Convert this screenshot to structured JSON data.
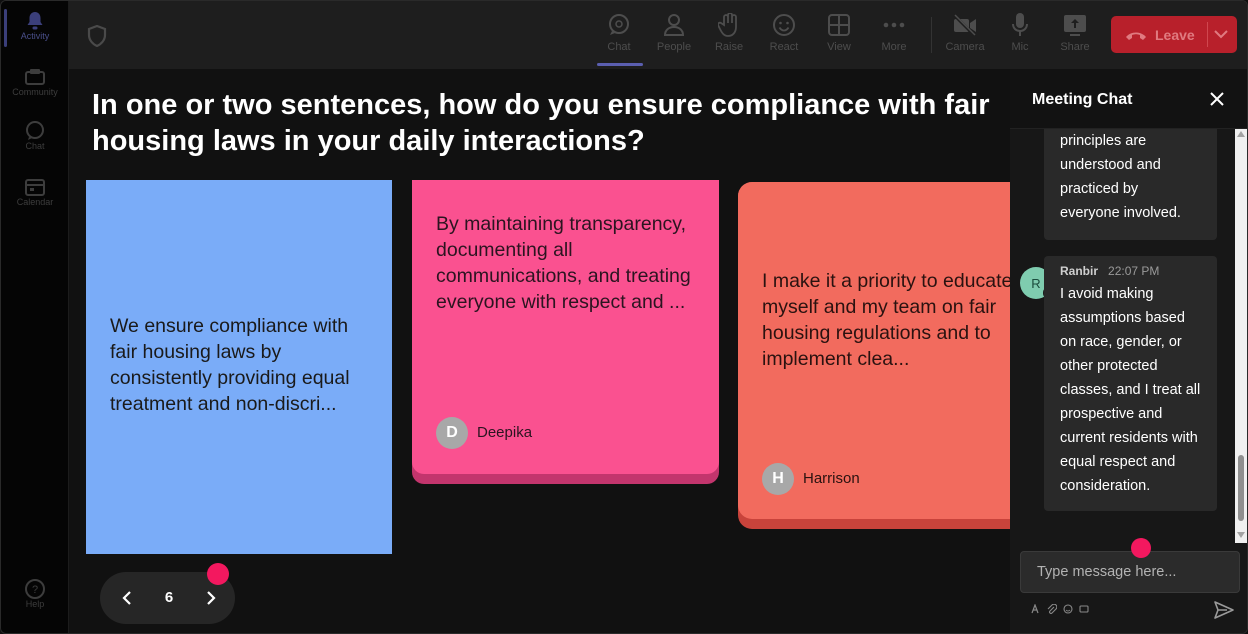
{
  "rail": {
    "items": [
      {
        "label": "Activity",
        "icon": "bell-icon",
        "active": true
      },
      {
        "label": "Community",
        "icon": "community-icon"
      },
      {
        "label": "Chat",
        "icon": "chat-icon"
      },
      {
        "label": "Calendar",
        "icon": "calendar-icon"
      }
    ],
    "help": {
      "label": "Help",
      "icon": "help-icon"
    }
  },
  "toolbar": {
    "chat": "Chat",
    "people": "People",
    "raise": "Raise",
    "react": "React",
    "view": "View",
    "more": "More",
    "camera": "Camera",
    "mic": "Mic",
    "share": "Share",
    "leave": "Leave"
  },
  "main": {
    "question": "In one or two sentences, how do you ensure compliance with fair housing laws in your daily interactions?",
    "cards": [
      {
        "text": "We ensure compliance with fair housing laws by consistently providing equal treatment and non-discri...",
        "color": "#7aacf8"
      },
      {
        "text": "By maintaining transparency, documenting all communications, and treating everyone with respect and ...",
        "author": "Deepika",
        "initial": "D",
        "color": "#fa5190"
      },
      {
        "text": "I make it a priority to educate myself and my team on fair housing regulations and to implement clea...",
        "author": "Harrison",
        "initial": "H",
        "color": "#f26b5e"
      }
    ],
    "pager": {
      "page": "6"
    }
  },
  "chat": {
    "title": "Meeting Chat",
    "messages": [
      {
        "text": "principles are understood and practiced by everyone involved."
      },
      {
        "author": "Ranbir",
        "initial": "R",
        "time": "22:07 PM",
        "text": "I avoid making assumptions based on race, gender, or other protected classes, and I treat all prospective and current residents with equal respect and consideration."
      }
    ],
    "input_placeholder": "Type message here..."
  },
  "colors": {
    "accent": "#f3185f",
    "leave": "#b8202b"
  }
}
